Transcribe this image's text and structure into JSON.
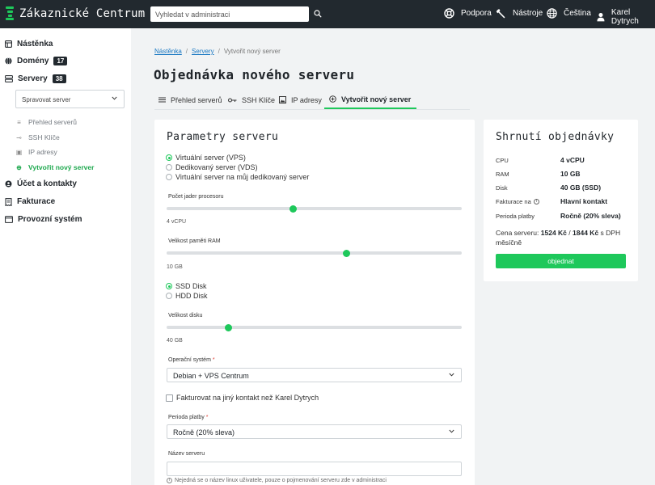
{
  "header": {
    "title": "Zákaznické Centrum",
    "search_placeholder": "Vyhledat v administraci",
    "support": "Podpora",
    "tools": "Nástroje",
    "language": "Čeština",
    "user": "Karel Dytrych",
    "brand_color": "#1ec85b"
  },
  "sidebar": {
    "dashboard": "Nástěnka",
    "domains": "Domény",
    "domains_count": "17",
    "servers": "Servery",
    "servers_count": "38",
    "manage_select": "Spravovat server",
    "sub_items": [
      "Přehled serverů",
      "SSH Klíče",
      "IP adresy",
      "Vytvořit nový server"
    ],
    "account": "Účet a kontakty",
    "invoices": "Fakturace",
    "system": "Provozní systém"
  },
  "breadcrumb": [
    "Nástěnka",
    "Servery",
    "Vytvořit nový server"
  ],
  "page_title": "Objednávka nového serveru",
  "tabs": [
    "Přehled serverů",
    "SSH Klíče",
    "IP adresy",
    "Vytvořit nový server"
  ],
  "params": {
    "title": "Parametry serveru",
    "server_types": [
      "Virtuální server (VPS)",
      "Dedikovaný server (VDS)",
      "Virtuální server na můj dedikovaný server"
    ],
    "server_type_selected": 0,
    "cpu_label": "Počet jader procesoru",
    "cpu_value": "4 vCPU",
    "cpu_fraction": 0.43,
    "ram_label": "Velikost paměti RAM",
    "ram_value": "10 GB",
    "ram_fraction": 0.61,
    "disk_types": [
      "SSD Disk",
      "HDD Disk"
    ],
    "disk_type_selected": 0,
    "disk_label": "Velikost disku",
    "disk_value": "40 GB",
    "disk_fraction": 0.21,
    "os_label": "Operační systém",
    "os_value": "Debian + VPS Centrum",
    "other_contact": "Fakturovat na jiný kontakt než Karel Dytrych",
    "period_label": "Perioda platby",
    "period_value": "Ročně (20% sleva)",
    "name_label": "Název serveru",
    "name_hint": "Nejedná se o název linux uživatele, pouze o pojmenování serveru zde v administraci",
    "required_mark": "*"
  },
  "summary": {
    "title": "Shrnutí objednávky",
    "rows": [
      {
        "label": "CPU",
        "value": "4 vCPU"
      },
      {
        "label": "RAM",
        "value": "10 GB"
      },
      {
        "label": "Disk",
        "value": "40 GB (SSD)"
      },
      {
        "label": "Fakturace na",
        "value": "Hlavní kontakt"
      },
      {
        "label": "Perioda platby",
        "value": "Ročně (20% sleva)"
      }
    ],
    "price_prefix": "Cena serveru:",
    "price_monthly": "1524 Kč",
    "price_sep": "/",
    "price_vat": "1844 Kč",
    "price_suffix": "s DPH měsíčně",
    "order_button": "objednat"
  }
}
